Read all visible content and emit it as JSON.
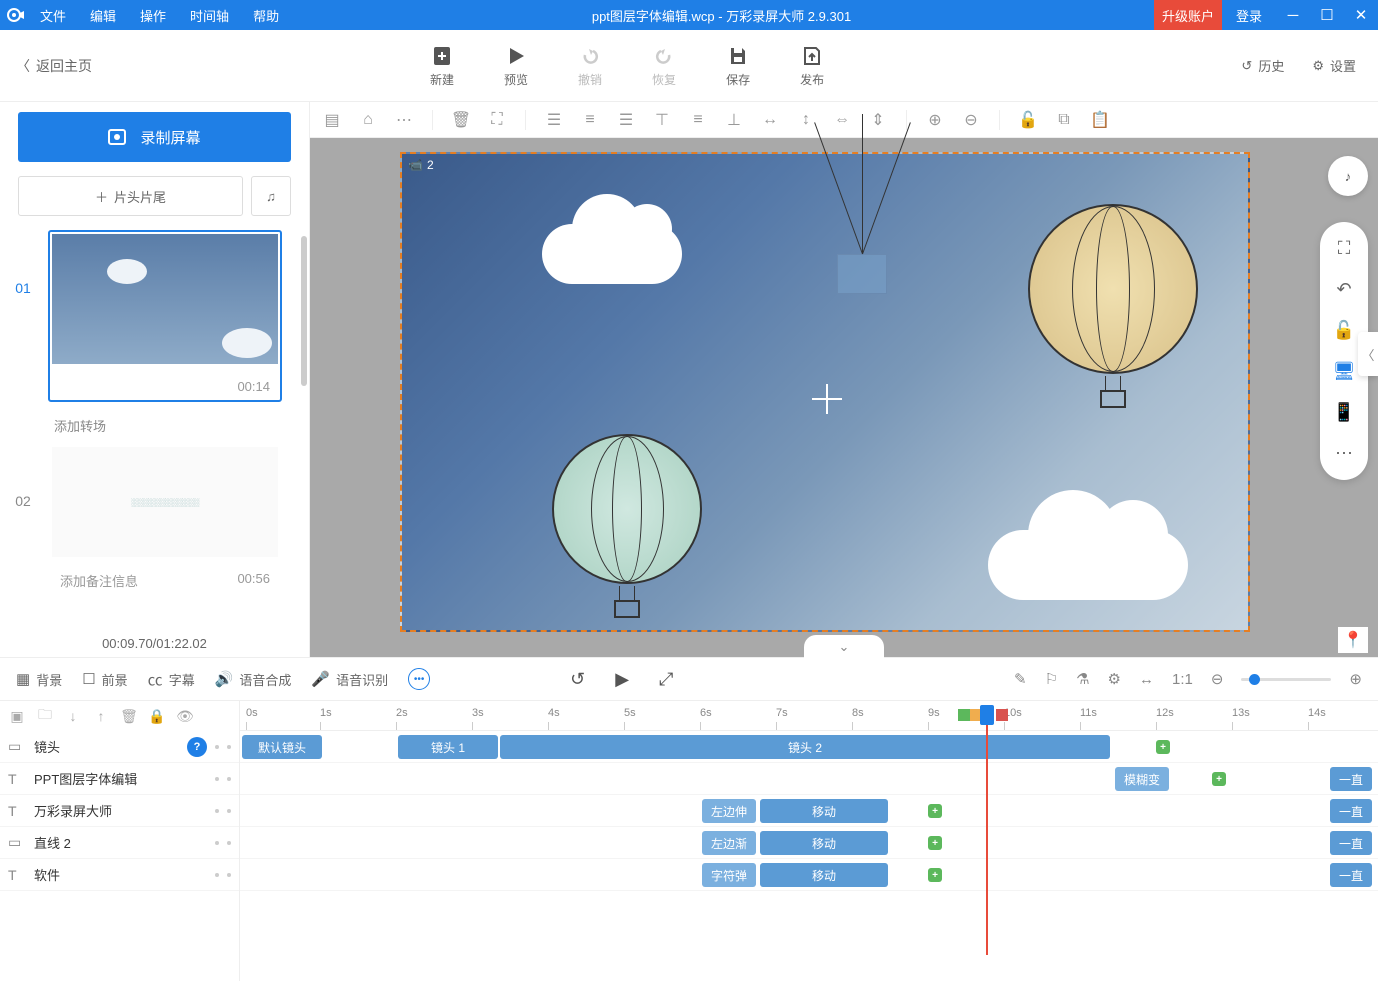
{
  "titlebar": {
    "menu": [
      "文件",
      "编辑",
      "操作",
      "时间轴",
      "帮助"
    ],
    "title": "ppt图层字体编辑.wcp - 万彩录屏大师 2.9.301",
    "upgrade": "升级账户",
    "login": "登录"
  },
  "toptool": {
    "back": "返回主页",
    "actions": [
      {
        "id": "new",
        "label": "新建"
      },
      {
        "id": "preview",
        "label": "预览"
      },
      {
        "id": "undo",
        "label": "撤销",
        "disabled": true
      },
      {
        "id": "redo",
        "label": "恢复",
        "disabled": true
      },
      {
        "id": "save",
        "label": "保存"
      },
      {
        "id": "publish",
        "label": "发布"
      }
    ],
    "history": "历史",
    "settings": "设置"
  },
  "left": {
    "record": "录制屏幕",
    "add_heads": "片头片尾",
    "slides": [
      {
        "num": "01",
        "time": "00:14",
        "transition": "添加转场"
      },
      {
        "num": "02",
        "note": "添加备注信息",
        "time": "00:56"
      }
    ],
    "timecode": "00:09.70/01:22.02"
  },
  "canvas": {
    "stage_tag": "2"
  },
  "bottombar": {
    "tabs": [
      {
        "id": "bg",
        "label": "背景"
      },
      {
        "id": "fg",
        "label": "前景"
      },
      {
        "id": "sub",
        "label": "字幕"
      },
      {
        "id": "tts",
        "label": "语音合成"
      },
      {
        "id": "asr",
        "label": "语音识别"
      }
    ]
  },
  "timeline": {
    "ruler": [
      "0s",
      "1s",
      "2s",
      "3s",
      "4s",
      "5s",
      "6s",
      "7s",
      "8s",
      "9s",
      "10s",
      "11s",
      "12s",
      "13s",
      "14s"
    ],
    "tracks": [
      {
        "icon": "cam",
        "name": "镜头",
        "help": true
      },
      {
        "icon": "T",
        "name": "PPT图层字体编辑"
      },
      {
        "icon": "T",
        "name": "万彩录屏大师"
      },
      {
        "icon": "line",
        "name": "直线 2"
      },
      {
        "icon": "T",
        "name": "软件"
      }
    ],
    "clips": {
      "default_shot": "默认镜头",
      "shot1": "镜头 1",
      "shot2": "镜头 2",
      "blur": "模糊变",
      "stretch": "左边伸",
      "fade": "左边渐",
      "chartype": "字符弹",
      "move": "移动",
      "always": "一直"
    }
  }
}
